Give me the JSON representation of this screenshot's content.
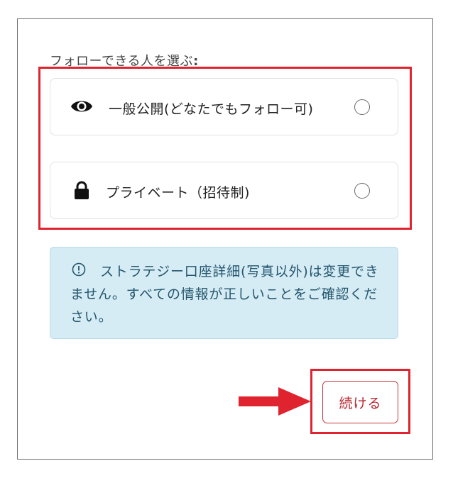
{
  "form": {
    "heading": "フォローできる人を選ぶ",
    "heading_colon": ":"
  },
  "options": [
    {
      "icon": "eye-icon",
      "label": "一般公開(どなたでもフォロー可)",
      "selected": false
    },
    {
      "icon": "lock-icon",
      "label": "プライベート（招待制)",
      "selected": false
    }
  ],
  "notice": {
    "icon": "info-circle-icon",
    "text": "ストラテジー口座詳細(写真以外)は変更できません。すべての情報が正しいことをご確認ください。"
  },
  "actions": {
    "continue_label": "続ける"
  },
  "colors": {
    "annotation": "#e0242f",
    "accent": "#b3262e",
    "notice_bg": "#d6ecf5",
    "notice_text": "#24566d"
  }
}
